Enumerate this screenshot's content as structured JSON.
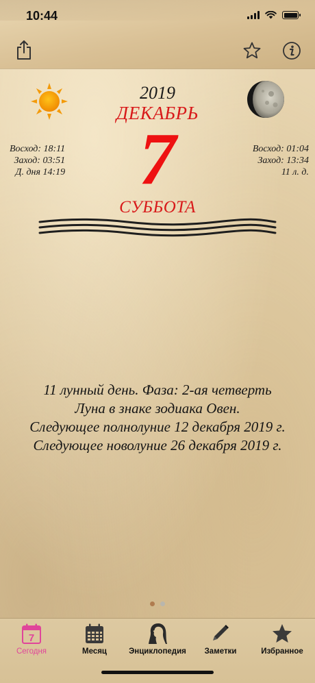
{
  "status_bar": {
    "time": "10:44"
  },
  "calendar": {
    "year": "2019",
    "month": "ДЕКАБРЬ",
    "day": "7",
    "weekday": "СУББОТА"
  },
  "sun": {
    "rise": "Восход: 18:11",
    "set": "Заход: 03:51",
    "day_length": "Д. дня 14:19"
  },
  "moon": {
    "rise": "Восход: 01:04",
    "set": "Заход: 13:34",
    "lunar_day": "11 л. д."
  },
  "lunar_info": {
    "line1": "11 лунный день. Фаза: 2-ая четверть",
    "line2": "Луна в знаке зодиака Овен.",
    "line3": "Следующее полнолуние 12 декабря 2019 г.",
    "line4": "Следующее новолуние 26 декабря 2019 г."
  },
  "pager": {
    "pages": 2,
    "current": 1
  },
  "tabbar": {
    "items": [
      {
        "label": "Сегодня",
        "icon": "calendar-today-icon",
        "icon_text": "7",
        "active": true
      },
      {
        "label": "Месяц",
        "icon": "calendar-month-icon",
        "active": false
      },
      {
        "label": "Энциклопедия",
        "icon": "woman-profile-icon",
        "active": false
      },
      {
        "label": "Заметки",
        "icon": "pencil-icon",
        "active": false
      },
      {
        "label": "Избранное",
        "icon": "star-icon",
        "active": false
      }
    ]
  },
  "colors": {
    "accent_red": "#d8191a",
    "tab_active": "#e0459a",
    "tab_inactive": "#111111",
    "icon_dark": "#2a2a2a"
  }
}
